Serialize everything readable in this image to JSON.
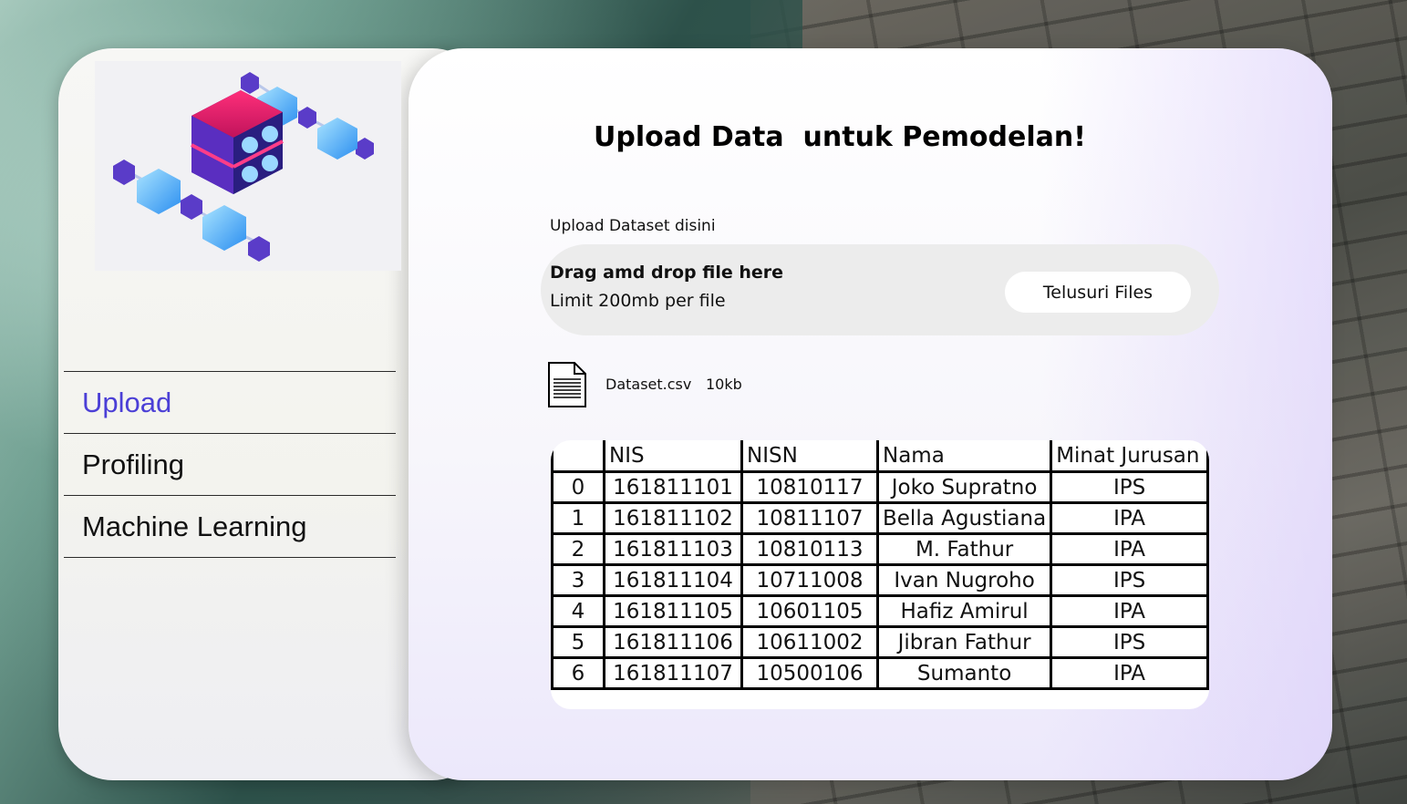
{
  "sidebar": {
    "items": [
      {
        "label": "Upload",
        "active": true
      },
      {
        "label": "Profiling",
        "active": false
      },
      {
        "label": "Machine Learning",
        "active": false
      }
    ],
    "illustration_icon": "data-server-network-illustration"
  },
  "main": {
    "title": "Upload Data  untuk Pemodelan!",
    "upload_label": "Upload Dataset disini",
    "dropzone": {
      "title": "Drag amd drop file here",
      "subtitle": "Limit 200mb per file",
      "browse_label": "Telusuri Files"
    },
    "file": {
      "icon": "document-icon",
      "name": "Dataset.csv",
      "size": "10kb"
    },
    "table": {
      "headers": [
        "",
        "NIS",
        "NISN",
        "Nama",
        "Minat Jurusan"
      ],
      "rows": [
        [
          "0",
          "161811101",
          "10810117",
          "Joko Supratno",
          "IPS"
        ],
        [
          "1",
          "161811102",
          "10811107",
          "Bella Agustiana",
          "IPA"
        ],
        [
          "2",
          "161811103",
          "10810113",
          "M. Fathur",
          "IPA"
        ],
        [
          "3",
          "161811104",
          "10711008",
          "Ivan Nugroho",
          "IPS"
        ],
        [
          "4",
          "161811105",
          "10601105",
          "Hafiz Amirul",
          "IPA"
        ],
        [
          "5",
          "161811106",
          "10611002",
          "Jibran Fathur",
          "IPS"
        ],
        [
          "6",
          "161811107",
          "10500106",
          "Sumanto",
          "IPA"
        ]
      ]
    }
  },
  "colors": {
    "active_nav": "#4b3fd6",
    "dropzone_bg": "#ececec"
  }
}
